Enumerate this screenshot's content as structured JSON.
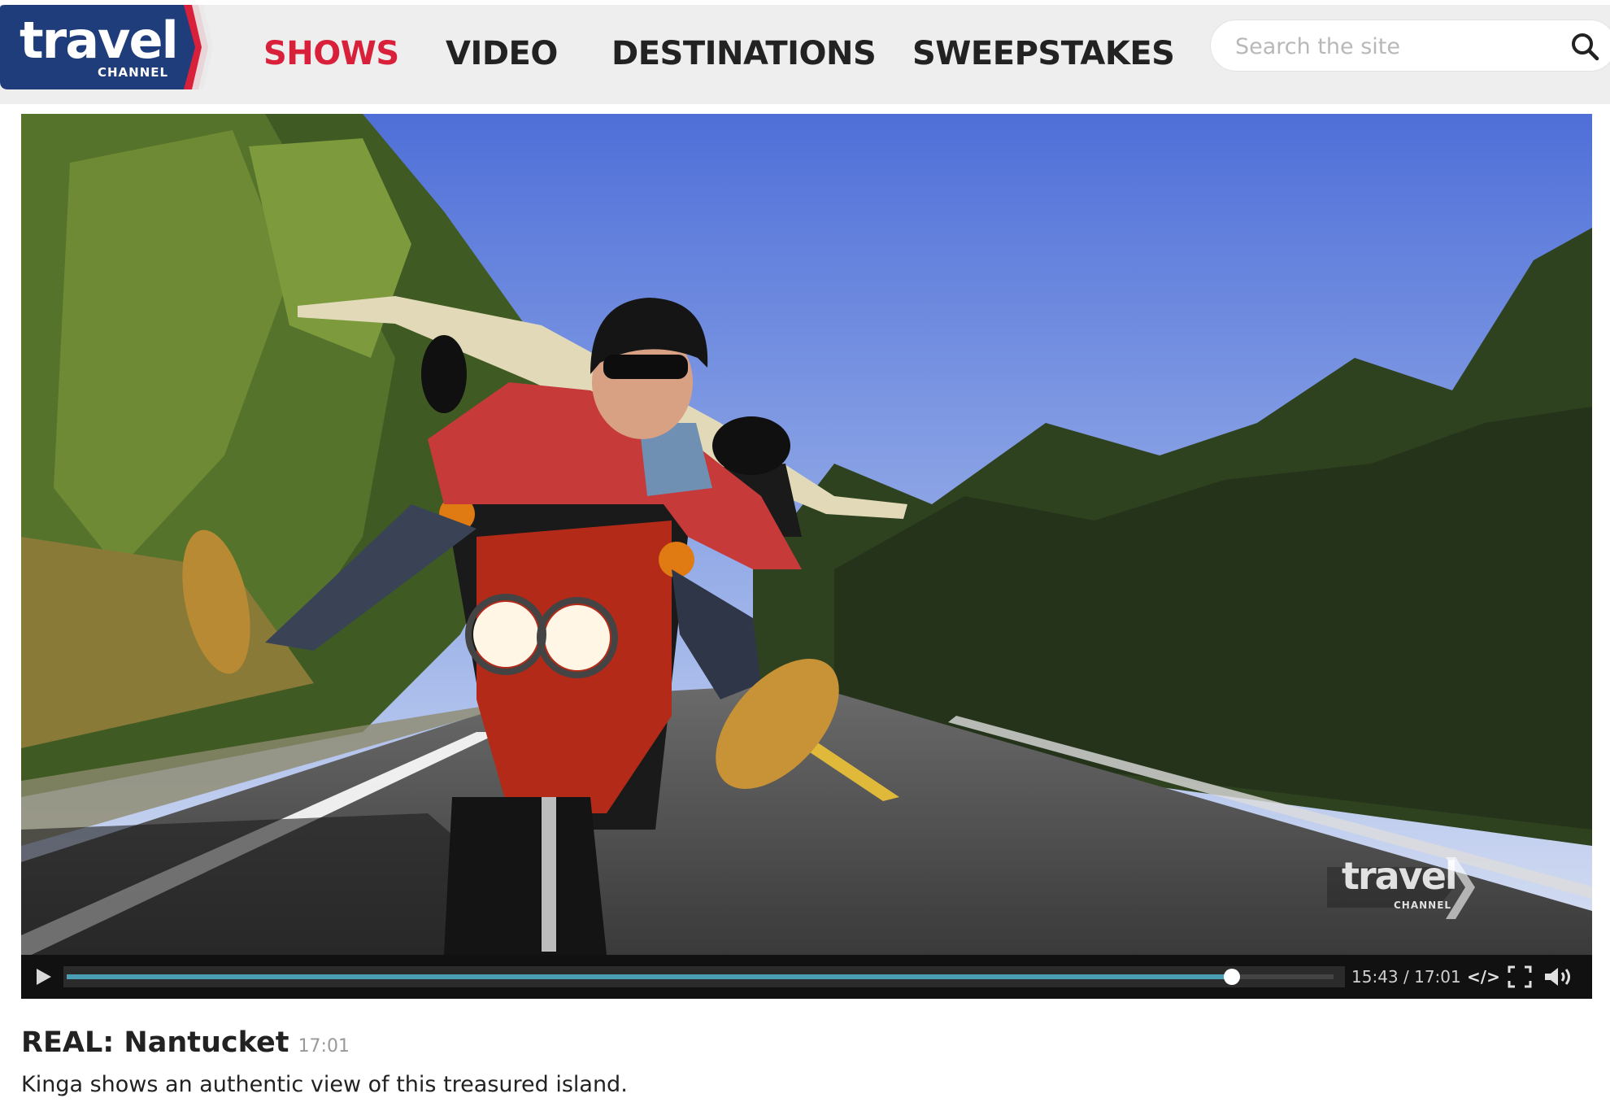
{
  "brand": {
    "logo_main": "travel",
    "logo_sub": "CHANNEL",
    "colors": {
      "navy": "#1f3d7a",
      "red": "#d9203a",
      "nav_active": "#d9203a"
    }
  },
  "nav": {
    "items": [
      {
        "label": "SHOWS",
        "active": true
      },
      {
        "label": "VIDEO",
        "active": false
      },
      {
        "label": "DESTINATIONS",
        "active": false
      },
      {
        "label": "SWEEPSTAKES",
        "active": false
      }
    ]
  },
  "search": {
    "placeholder": "Search the site",
    "value": "",
    "icon": "search-icon"
  },
  "video": {
    "watermark_main": "travel",
    "watermark_sub": "CHANNEL",
    "progress_fraction": 0.9197,
    "current_time": "15:43",
    "separator": "/",
    "duration": "17:01",
    "controls": [
      "play-icon",
      "embed-icon",
      "fullscreen-icon",
      "volume-icon"
    ],
    "embed_label": "</>"
  },
  "caption": {
    "title": "REAL: Nantucket",
    "duration": "17:01",
    "description": "Kinga shows an authentic view of this treasured island."
  }
}
